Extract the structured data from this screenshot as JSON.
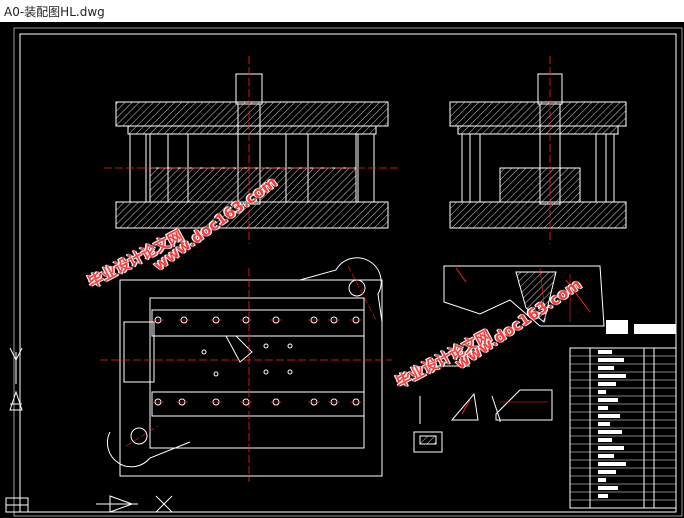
{
  "window": {
    "title": "A0-装配图HL.dwg"
  },
  "watermarks": [
    {
      "line1": "毕业设计论文网",
      "line2": "www.doc163.com"
    },
    {
      "line1": "毕业设计论文网",
      "line2": "www.doc163.com"
    }
  ],
  "colors": {
    "background": "#000000",
    "drawing_white": "#ffffff",
    "centerline_red": "#ff2020",
    "watermark_red": "#ff3a3a",
    "hatch": "#d0d0d0"
  },
  "icons": [
    "ucs-axis-icon",
    "triangle-arrow-icon",
    "close-x-icon"
  ]
}
